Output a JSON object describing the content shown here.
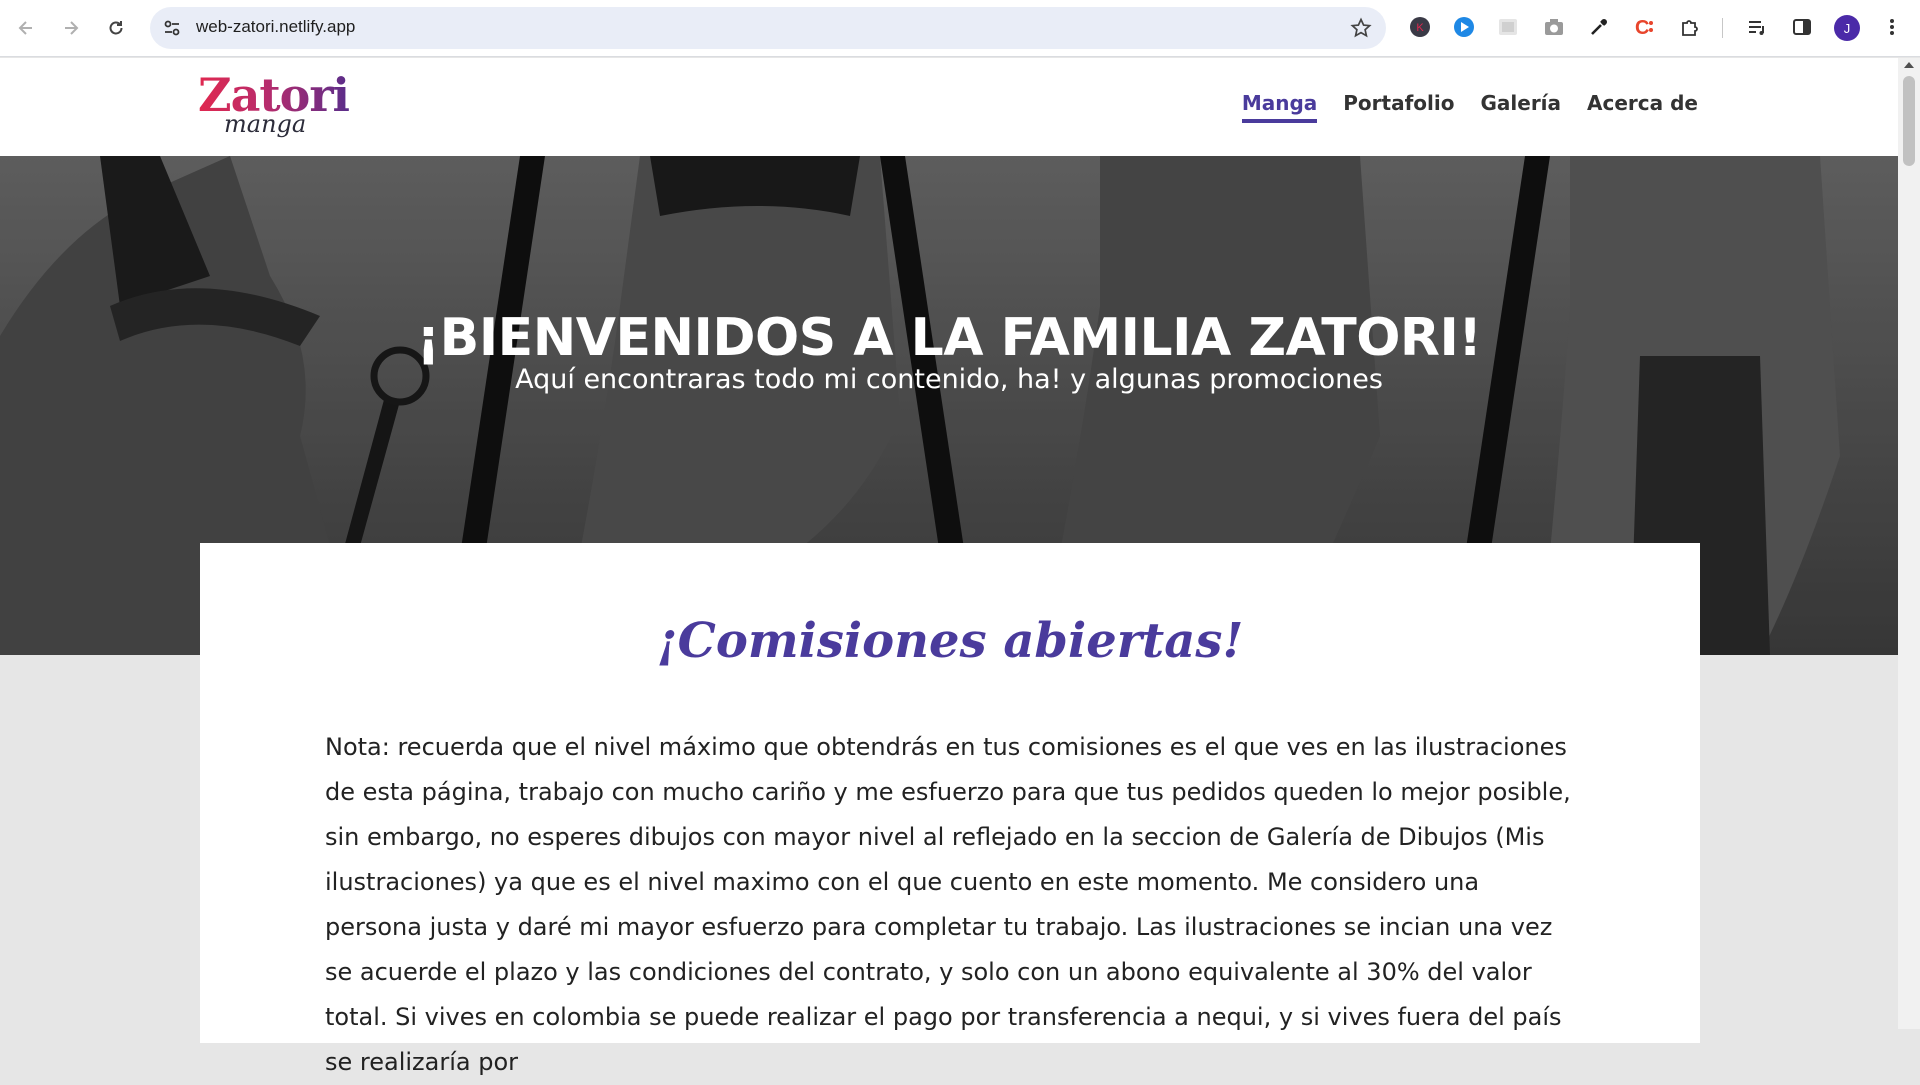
{
  "browser": {
    "url": "web-zatori.netlify.app",
    "profile_initial": "J",
    "icons": [
      "back-icon",
      "forward-icon",
      "reload-icon",
      "site-info-icon",
      "bookmark-star-icon",
      "extension-k-icon",
      "extension-play-icon",
      "extension-image-icon",
      "camera-icon",
      "eyedropper-icon",
      "extension-c-icon",
      "extensions-puzzle-icon",
      "media-queue-icon",
      "side-panel-icon",
      "menu-dots-icon"
    ]
  },
  "site": {
    "logo": {
      "line1": "Zatori",
      "line2": "manga"
    },
    "nav": [
      {
        "label": "Manga",
        "active": true
      },
      {
        "label": "Portafolio",
        "active": false
      },
      {
        "label": "Galería",
        "active": false
      },
      {
        "label": "Acerca de",
        "active": false
      }
    ],
    "accent_color": "#4a3b9c"
  },
  "hero": {
    "title": "¡BIENVENIDOS A LA FAMILIA ZATORI!",
    "subtitle": "Aquí encontraras todo mi contenido, ha! y algunas promociones"
  },
  "content": {
    "heading": "¡Comisiones abiertas!",
    "paragraph": "Nota: recuerda que el nivel máximo que obtendrás en tus comisiones es el que ves en las ilustraciones de esta página, trabajo con mucho cariño y me esfuerzo para que tus pedidos queden lo mejor posible, sin embargo, no esperes dibujos con mayor nivel al reflejado en la seccion de Galería de Dibujos (Mis ilustraciones) ya que es el nivel maximo con el que cuento en este momento. Me considero una persona justa y daré mi mayor esfuerzo para completar tu trabajo. Las ilustraciones se incian una vez se acuerde el plazo y las condiciones del contrato, y solo con un abono equivalente al 30% del valor total. Si vives en colombia se puede realizar el pago por transferencia a nequi, y si vives fuera del país se realizaría por"
  }
}
